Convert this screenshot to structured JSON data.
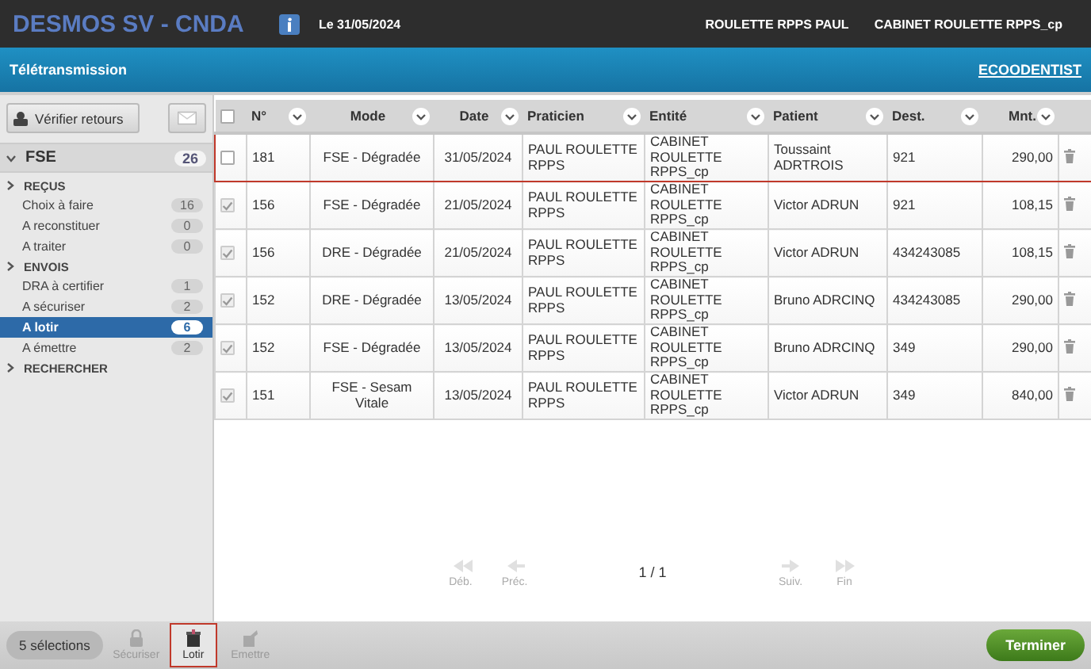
{
  "header": {
    "title": "DESMOS SV - CNDA",
    "date": "Le 31/05/2024",
    "user": "ROULETTE RPPS PAUL",
    "cabinet": "CABINET ROULETTE RPPS_cp"
  },
  "subheader": {
    "title": "Télétransmission",
    "link": "ECOODENTIST"
  },
  "sidebar": {
    "verify_button": "Vérifier retours",
    "group": {
      "label": "FSE",
      "count": "26",
      "expanded": true
    },
    "sections": [
      {
        "label": "REÇUS",
        "items": [
          {
            "label": "Choix à faire",
            "count": "16",
            "selected": false
          },
          {
            "label": "A reconstituer",
            "count": "0",
            "selected": false
          },
          {
            "label": "A traiter",
            "count": "0",
            "selected": false
          }
        ]
      },
      {
        "label": "ENVOIS",
        "items": [
          {
            "label": "DRA à certifier",
            "count": "1",
            "selected": false
          },
          {
            "label": "A sécuriser",
            "count": "2",
            "selected": false
          },
          {
            "label": "A lotir",
            "count": "6",
            "selected": true
          },
          {
            "label": "A émettre",
            "count": "2",
            "selected": false
          }
        ]
      },
      {
        "label": "RECHERCHER"
      }
    ]
  },
  "table": {
    "all_checked": false,
    "columns": [
      {
        "label": "N°"
      },
      {
        "label": "Mode"
      },
      {
        "label": "Date"
      },
      {
        "label": "Praticien"
      },
      {
        "label": "Entité"
      },
      {
        "label": "Patient"
      },
      {
        "label": "Dest."
      },
      {
        "label": "Mnt."
      }
    ],
    "rows": [
      {
        "checked": false,
        "highlighted": true,
        "cells": [
          "181",
          "FSE - Dégradée",
          "31/05/2024",
          "PAUL ROULETTE RPPS",
          "CABINET ROULETTE RPPS_cp",
          "Toussaint ADRTROIS",
          "921",
          "290,00"
        ]
      },
      {
        "checked": true,
        "highlighted": false,
        "cells": [
          "156",
          "FSE - Dégradée",
          "21/05/2024",
          "PAUL ROULETTE RPPS",
          "CABINET ROULETTE RPPS_cp",
          "Victor ADRUN",
          "921",
          "108,15"
        ]
      },
      {
        "checked": true,
        "highlighted": false,
        "cells": [
          "156",
          "DRE - Dégradée",
          "21/05/2024",
          "PAUL ROULETTE RPPS",
          "CABINET ROULETTE RPPS_cp",
          "Victor ADRUN",
          "434243085",
          "108,15"
        ]
      },
      {
        "checked": true,
        "highlighted": false,
        "cells": [
          "152",
          "DRE - Dégradée",
          "13/05/2024",
          "PAUL ROULETTE RPPS",
          "CABINET ROULETTE RPPS_cp",
          "Bruno ADRCINQ",
          "434243085",
          "290,00"
        ]
      },
      {
        "checked": true,
        "highlighted": false,
        "cells": [
          "152",
          "FSE - Dégradée",
          "13/05/2024",
          "PAUL ROULETTE RPPS",
          "CABINET ROULETTE RPPS_cp",
          "Bruno ADRCINQ",
          "349",
          "290,00"
        ]
      },
      {
        "checked": true,
        "highlighted": false,
        "cells": [
          "151",
          "FSE - Sesam Vitale",
          "13/05/2024",
          "PAUL ROULETTE RPPS",
          "CABINET ROULETTE RPPS_cp",
          "Victor ADRUN",
          "349",
          "840,00"
        ]
      }
    ]
  },
  "pagination": {
    "page": "1 / 1",
    "buttons": [
      {
        "label": "Déb.",
        "kind": "first",
        "disabled": true
      },
      {
        "label": "Préc.",
        "kind": "prev",
        "disabled": true
      },
      {
        "label": "Suiv.",
        "kind": "next",
        "disabled": true
      },
      {
        "label": "Fin",
        "kind": "last",
        "disabled": true
      }
    ]
  },
  "footer": {
    "selection": "5 sélections",
    "actions": [
      {
        "label": "Sécuriser",
        "kind": "lock",
        "disabled": true,
        "selected": false
      },
      {
        "label": "Lotir",
        "kind": "box",
        "disabled": false,
        "selected": true
      },
      {
        "label": "Emettre",
        "kind": "send",
        "disabled": true,
        "selected": false
      }
    ],
    "finish": "Terminer"
  }
}
